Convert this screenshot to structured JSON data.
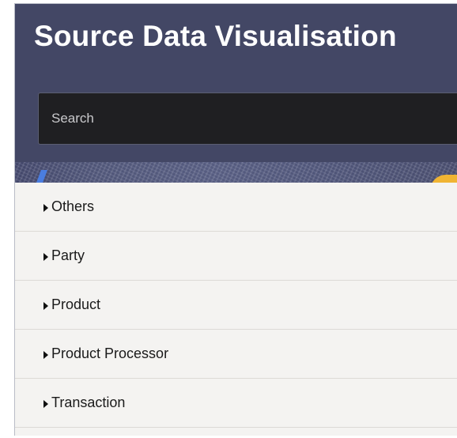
{
  "header": {
    "title": "Source Data Visualisation",
    "background_color": "#434765"
  },
  "search": {
    "placeholder": "Search",
    "value": ""
  },
  "list": {
    "expand_icon": "caret-right-icon",
    "items": [
      {
        "label": "Others"
      },
      {
        "label": "Party"
      },
      {
        "label": "Product"
      },
      {
        "label": "Product Processor"
      },
      {
        "label": "Transaction"
      }
    ]
  }
}
